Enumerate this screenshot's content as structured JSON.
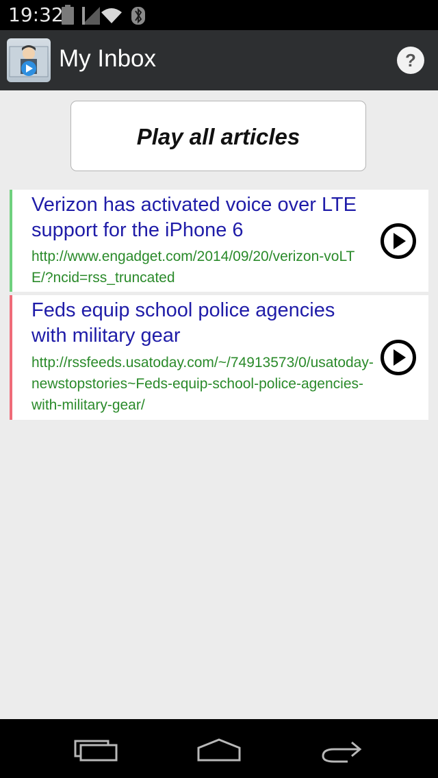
{
  "status_bar": {
    "time": "19:32"
  },
  "action_bar": {
    "title": "My Inbox",
    "help_label": "?"
  },
  "play_all": {
    "label": "Play all articles"
  },
  "articles": [
    {
      "title": "Verizon has activated voice over LTE support for the iPhone 6",
      "url": "http://www.engadget.com/2014/09/20/verizon-voLTE/?ncid=rss_truncated",
      "accent_color": "#6fd07e"
    },
    {
      "title": "Feds equip school police agencies with military gear",
      "url": "http://rssfeeds.usatoday.com/~/74913573/0/usatoday-newstopstories~Feds-equip-school-police-agencies-with-military-gear/",
      "accent_color": "#ef6b78"
    }
  ],
  "icons": {
    "status": [
      "battery-icon",
      "signal-icon",
      "wifi-icon",
      "bluetooth-icon"
    ],
    "app": "app-logo-icon",
    "article_action": "play-circle-icon",
    "nav": [
      "recents-icon",
      "home-icon",
      "back-icon"
    ]
  },
  "colors": {
    "action_bar_bg": "#2d2f31",
    "title_link": "#1f1ca8",
    "url_text": "#2a8a2a"
  }
}
